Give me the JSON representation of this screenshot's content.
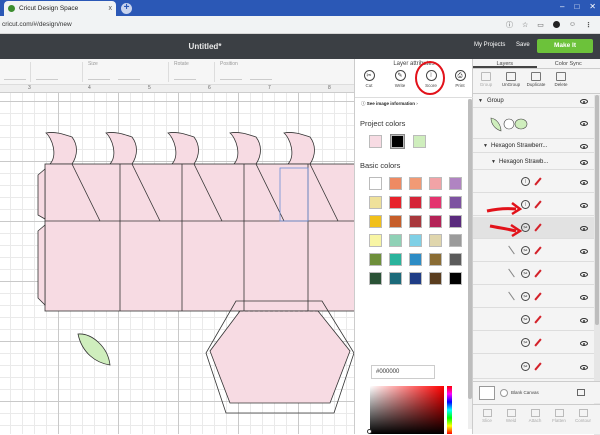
{
  "browser": {
    "tab_title": "Cricut Design Space",
    "tab_close": "x",
    "new_tab": "+",
    "url": "cricut.com/#/design/new",
    "window_controls": [
      "–",
      "□",
      "✕"
    ]
  },
  "header": {
    "doc_title": "Untitled*",
    "my_projects": "My Projects",
    "save": "Save",
    "make_it": "Make It"
  },
  "edit_toolbar": {
    "labels": [
      "Size",
      "Rotate",
      "Position"
    ]
  },
  "ruler": {
    "numbers": [
      "3",
      "4",
      "5",
      "6",
      "7",
      "8"
    ]
  },
  "layer_attributes": {
    "title": "Layer attributes",
    "buttons": [
      {
        "label": "Cut",
        "glyph": "✂"
      },
      {
        "label": "Write",
        "glyph": "✎"
      },
      {
        "label": "Score",
        "glyph": "⦚"
      },
      {
        "label": "Print",
        "glyph": "⎙"
      }
    ],
    "see_info": "See image information",
    "project_colors_title": "Project colors",
    "project_colors": [
      "#f7dbe3",
      "#000000",
      "#cfeebd"
    ],
    "basic_colors_title": "Basic colors",
    "basic_colors": [
      "#ffffff",
      "#ee8a63",
      "#f19a75",
      "#f1a3a6",
      "#b084c2",
      "#efe19a",
      "#e7222b",
      "#d52438",
      "#e4346f",
      "#7d52a1",
      "#f1c01a",
      "#c65e2a",
      "#a8383d",
      "#b42357",
      "#5b2b7e",
      "#f8f5a4",
      "#8fd1b6",
      "#7fd0e6",
      "#e0d6ad",
      "#9b9b9b",
      "#6e8f3a",
      "#2ab39c",
      "#2d8cc5",
      "#8a6c34",
      "#5b5b5b",
      "#2a5236",
      "#1b6a7a",
      "#1f3d86",
      "#5a3d1e",
      "#000000"
    ],
    "hex_value": "#000000"
  },
  "layers_panel": {
    "tabs": [
      "Layers",
      "Color Sync"
    ],
    "tools": [
      "Group",
      "UnGroup",
      "Duplicate",
      "Delete"
    ],
    "rows": [
      {
        "name": "Group"
      },
      {
        "name": "Hexagon Strawberr..."
      },
      {
        "name": "Hexagon Strawb..."
      }
    ],
    "blank_canvas": "Blank Canvas",
    "bottom_tools": [
      "Slice",
      "Weld",
      "Attach",
      "Flatten",
      "Contour"
    ]
  }
}
